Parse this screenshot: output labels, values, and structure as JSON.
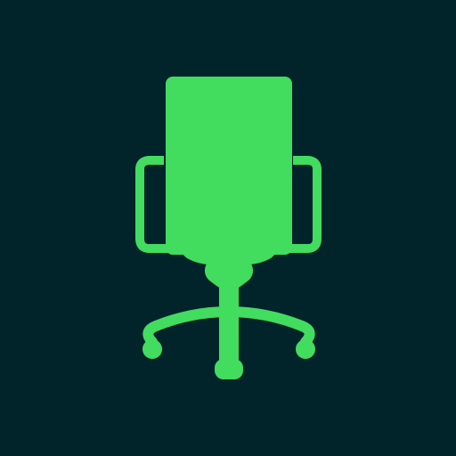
{
  "icon": {
    "name": "office-chair-icon",
    "background_color": "#00242a",
    "foreground_color": "#42dc5f"
  }
}
